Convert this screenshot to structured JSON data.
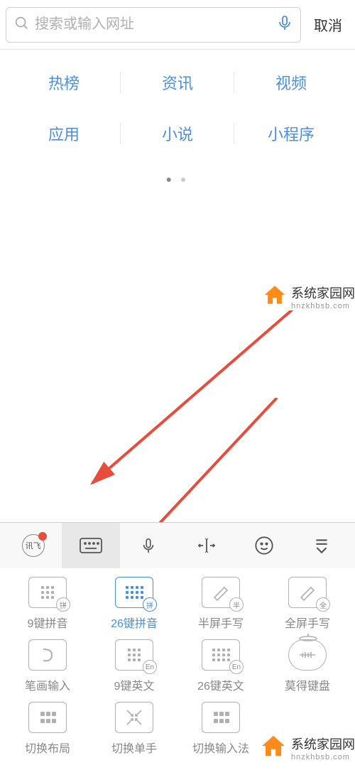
{
  "search": {
    "placeholder": "搜索或输入网址",
    "cancel": "取消"
  },
  "categories": {
    "row1": [
      "热榜",
      "资讯",
      "视频"
    ],
    "row2": [
      "应用",
      "小说",
      "小程序"
    ]
  },
  "toolbar": {
    "brand": "讯飞"
  },
  "layouts": [
    {
      "label": "9键拼音",
      "badge": "拼"
    },
    {
      "label": "26键拼音",
      "badge": "拼",
      "active": true
    },
    {
      "label": "半屏手写",
      "badge": "半"
    },
    {
      "label": "全屏手写",
      "badge": "全"
    },
    {
      "label": "笔画输入",
      "badge": ""
    },
    {
      "label": "9键英文",
      "badge": "En"
    },
    {
      "label": "26键英文",
      "badge": "En"
    },
    {
      "label": "莫得键盘",
      "badge": ""
    },
    {
      "label": "切换布局",
      "badge": ""
    },
    {
      "label": "切换单手",
      "badge": ""
    },
    {
      "label": "切换输入法",
      "badge": ""
    }
  ],
  "watermark": {
    "title": "系统家园网",
    "url": "hnzkhbsb.com"
  }
}
